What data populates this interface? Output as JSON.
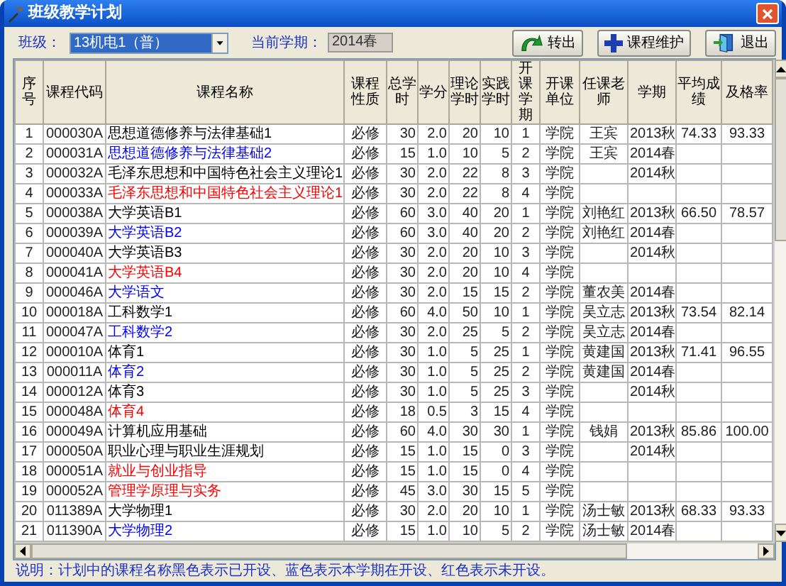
{
  "window": {
    "title": "班级教学计划"
  },
  "toolbar": {
    "class_label": "班级：",
    "class_value": "13机电1（普）",
    "term_label": "当前学期：",
    "term_value": "2014春",
    "buttons": [
      {
        "label": "转出",
        "kind": "export"
      },
      {
        "label": "课程维护",
        "kind": "add"
      },
      {
        "label": "退出",
        "kind": "exit"
      }
    ]
  },
  "table": {
    "columns": [
      "序号",
      "课程代码",
      "课程名称",
      "课程性质",
      "总学时",
      "学分",
      "理论学时",
      "实践学时",
      "开课学期",
      "开课单位",
      "任课老师",
      "学期",
      "平均成绩",
      "及格率"
    ],
    "rows": [
      {
        "kind": "done",
        "no": "1",
        "code": "000030A",
        "name": "思想道德修养与法律基础1",
        "type": "必修",
        "hours": "30",
        "credits": "2.0",
        "theory": "20",
        "practice": "10",
        "semester": "1",
        "dept": "学院",
        "teacher": "王宾",
        "term": "2013秋",
        "avg": "74.33",
        "pass": "93.33"
      },
      {
        "kind": "current",
        "no": "2",
        "code": "000031A",
        "name": "思想道德修养与法律基础2",
        "type": "必修",
        "hours": "15",
        "credits": "1.0",
        "theory": "10",
        "practice": "5",
        "semester": "2",
        "dept": "学院",
        "teacher": "王宾",
        "term": "2014春"
      },
      {
        "kind": "done",
        "no": "3",
        "code": "000032A",
        "name": "毛泽东思想和中国特色社会主义理论1",
        "type": "必修",
        "hours": "30",
        "credits": "2.0",
        "theory": "22",
        "practice": "8",
        "semester": "3",
        "dept": "学院",
        "term": "2014秋"
      },
      {
        "kind": "planned",
        "no": "4",
        "code": "000033A",
        "name": "毛泽东思想和中国特色社会主义理论1",
        "type": "必修",
        "hours": "30",
        "credits": "2.0",
        "theory": "22",
        "practice": "8",
        "semester": "4",
        "dept": "学院"
      },
      {
        "kind": "done",
        "no": "5",
        "code": "000038A",
        "name": "大学英语B1",
        "type": "必修",
        "hours": "60",
        "credits": "3.0",
        "theory": "40",
        "practice": "20",
        "semester": "1",
        "dept": "学院",
        "teacher": "刘艳红",
        "term": "2013秋",
        "avg": "66.50",
        "pass": "78.57"
      },
      {
        "kind": "current",
        "no": "6",
        "code": "000039A",
        "name": "大学英语B2",
        "type": "必修",
        "hours": "60",
        "credits": "3.0",
        "theory": "40",
        "practice": "20",
        "semester": "2",
        "dept": "学院",
        "teacher": "刘艳红",
        "term": "2014春"
      },
      {
        "kind": "done",
        "no": "7",
        "code": "000040A",
        "name": "大学英语B3",
        "type": "必修",
        "hours": "30",
        "credits": "2.0",
        "theory": "20",
        "practice": "10",
        "semester": "3",
        "dept": "学院",
        "term": "2014秋"
      },
      {
        "kind": "planned",
        "no": "8",
        "code": "000041A",
        "name": "大学英语B4",
        "type": "必修",
        "hours": "30",
        "credits": "2.0",
        "theory": "20",
        "practice": "10",
        "semester": "4",
        "dept": "学院"
      },
      {
        "kind": "current",
        "no": "9",
        "code": "000046A",
        "name": "大学语文",
        "type": "必修",
        "hours": "30",
        "credits": "2.0",
        "theory": "15",
        "practice": "15",
        "semester": "2",
        "dept": "学院",
        "teacher": "董农美",
        "term": "2014春"
      },
      {
        "kind": "done",
        "no": "10",
        "code": "000018A",
        "name": "工科数学1",
        "type": "必修",
        "hours": "60",
        "credits": "4.0",
        "theory": "50",
        "practice": "10",
        "semester": "1",
        "dept": "学院",
        "teacher": "吴立志",
        "term": "2013秋",
        "avg": "73.54",
        "pass": "82.14"
      },
      {
        "kind": "current",
        "no": "11",
        "code": "000047A",
        "name": "工科数学2",
        "type": "必修",
        "hours": "30",
        "credits": "2.0",
        "theory": "25",
        "practice": "5",
        "semester": "2",
        "dept": "学院",
        "teacher": "吴立志",
        "term": "2014春"
      },
      {
        "kind": "done",
        "no": "12",
        "code": "000010A",
        "name": "体育1",
        "type": "必修",
        "hours": "30",
        "credits": "1.0",
        "theory": "5",
        "practice": "25",
        "semester": "1",
        "dept": "学院",
        "teacher": "黄建国",
        "term": "2013秋",
        "avg": "71.41",
        "pass": "96.55"
      },
      {
        "kind": "current",
        "no": "13",
        "code": "000011A",
        "name": "体育2",
        "type": "必修",
        "hours": "30",
        "credits": "1.0",
        "theory": "5",
        "practice": "25",
        "semester": "2",
        "dept": "学院",
        "teacher": "黄建国",
        "term": "2014春"
      },
      {
        "kind": "done",
        "no": "14",
        "code": "000012A",
        "name": "体育3",
        "type": "必修",
        "hours": "30",
        "credits": "1.0",
        "theory": "5",
        "practice": "25",
        "semester": "3",
        "dept": "学院",
        "term": "2014秋"
      },
      {
        "kind": "planned",
        "no": "15",
        "code": "000048A",
        "name": "体育4",
        "type": "必修",
        "hours": "18",
        "credits": "0.5",
        "theory": "3",
        "practice": "15",
        "semester": "4",
        "dept": "学院"
      },
      {
        "kind": "done",
        "no": "16",
        "code": "000049A",
        "name": "计算机应用基础",
        "type": "必修",
        "hours": "60",
        "credits": "4.0",
        "theory": "30",
        "practice": "30",
        "semester": "1",
        "dept": "学院",
        "teacher": "钱娟",
        "term": "2013秋",
        "avg": "85.86",
        "pass": "100.00"
      },
      {
        "kind": "done",
        "no": "17",
        "code": "000050A",
        "name": "职业心理与职业生涯规划",
        "type": "必修",
        "hours": "15",
        "credits": "1.0",
        "theory": "15",
        "practice": "0",
        "semester": "3",
        "dept": "学院",
        "term": "2014秋"
      },
      {
        "kind": "planned",
        "no": "18",
        "code": "000051A",
        "name": "就业与创业指导",
        "type": "必修",
        "hours": "15",
        "credits": "1.0",
        "theory": "15",
        "practice": "0",
        "semester": "4",
        "dept": "学院"
      },
      {
        "kind": "planned",
        "no": "19",
        "code": "000052A",
        "name": "管理学原理与实务",
        "type": "必修",
        "hours": "45",
        "credits": "3.0",
        "theory": "30",
        "practice": "15",
        "semester": "5",
        "dept": "学院"
      },
      {
        "kind": "done",
        "no": "20",
        "code": "011389A",
        "name": "大学物理1",
        "type": "必修",
        "hours": "30",
        "credits": "2.0",
        "theory": "20",
        "practice": "10",
        "semester": "1",
        "dept": "学院",
        "teacher": "汤士敏",
        "term": "2013秋",
        "avg": "68.33",
        "pass": "93.33"
      },
      {
        "kind": "current",
        "no": "21",
        "code": "011390A",
        "name": "大学物理2",
        "type": "必修",
        "hours": "15",
        "credits": "1.0",
        "theory": "10",
        "practice": "5",
        "semester": "2",
        "dept": "学院",
        "teacher": "汤士敏",
        "term": "2014春"
      }
    ]
  },
  "note": "说明：计划中的课程名称黑色表示已开设、蓝色表示本学期在开设、红色表示未开设。"
}
